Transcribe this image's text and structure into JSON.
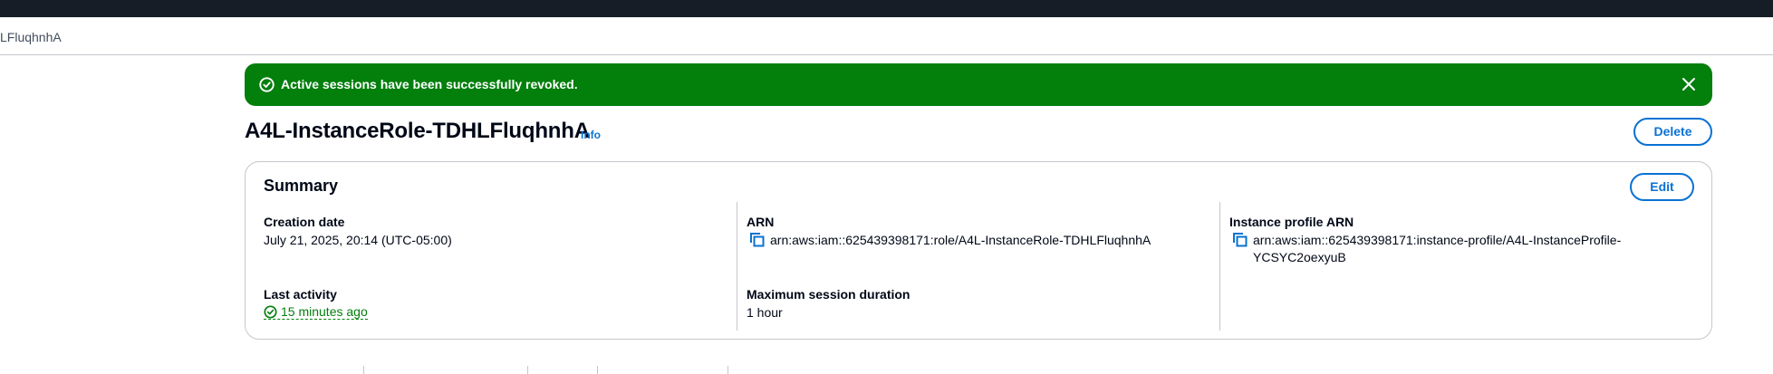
{
  "breadcrumb": {
    "current": "LFluqhnhA"
  },
  "flash": {
    "message": "Active sessions have been successfully revoked."
  },
  "header": {
    "title": "A4L-InstanceRole-TDHLFluqhnhA",
    "info_label": "Info",
    "delete_label": "Delete"
  },
  "summary": {
    "title": "Summary",
    "edit_label": "Edit",
    "creation_date": {
      "label": "Creation date",
      "value": "July 21, 2025, 20:14 (UTC-05:00)"
    },
    "last_activity": {
      "label": "Last activity",
      "value": "15 minutes ago"
    },
    "arn": {
      "label": "ARN",
      "value": "arn:aws:iam::625439398171:role/A4L-InstanceRole-TDHLFluqhnhA"
    },
    "max_session": {
      "label": "Maximum session duration",
      "value": "1 hour"
    },
    "instance_profile_arn": {
      "label": "Instance profile ARN",
      "value_line1": "arn:aws:iam::625439398171:instance-profile/A4L-InstanceProfile-",
      "value_line2": "YCSYC2oexyuB"
    }
  },
  "colors": {
    "success": "#037f0c",
    "link": "#0972d3",
    "topbar": "#161d26"
  },
  "icons": {
    "flash": "success-circle-icon",
    "close": "close-icon",
    "copy": "copy-icon",
    "status": "status-positive-icon"
  }
}
